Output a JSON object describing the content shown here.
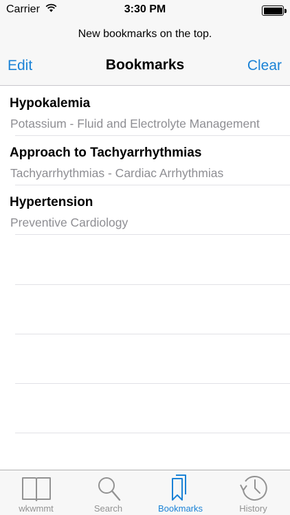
{
  "status_bar": {
    "carrier": "Carrier",
    "time": "3:30 PM"
  },
  "prompt": {
    "text": "New bookmarks on the top."
  },
  "nav": {
    "left": "Edit",
    "title": "Bookmarks",
    "right": "Clear"
  },
  "bookmarks": [
    {
      "title": "Hypokalemia",
      "subtitle": "Potassium - Fluid and Electrolyte Management"
    },
    {
      "title": "Approach to Tachyarrhythmias",
      "subtitle": "Tachyarrhythmias - Cardiac Arrhythmias"
    },
    {
      "title": "Hypertension",
      "subtitle": "Preventive Cardiology"
    }
  ],
  "tabs": [
    {
      "label": "wkwmmt",
      "icon": "book-icon"
    },
    {
      "label": "Search",
      "icon": "search-icon"
    },
    {
      "label": "Bookmarks",
      "icon": "bookmarks-icon",
      "active": true
    },
    {
      "label": "History",
      "icon": "history-icon"
    }
  ],
  "colors": {
    "accent": "#1a82d6",
    "inactive": "#929292",
    "subtitle": "#8e8e93"
  }
}
